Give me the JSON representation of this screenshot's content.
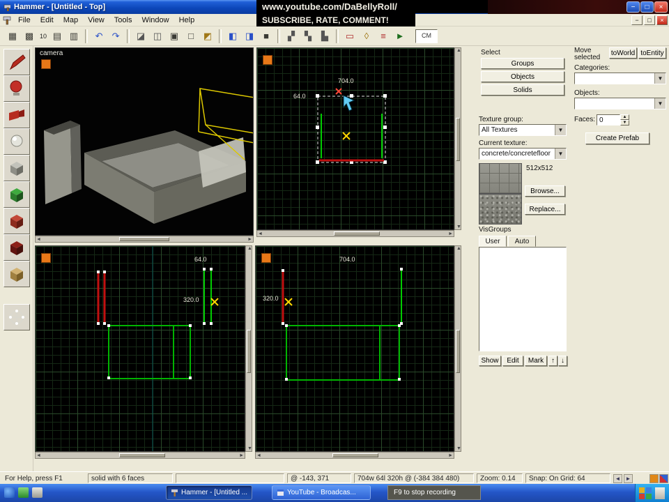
{
  "window": {
    "title": "Hammer - [Untitled - Top]"
  },
  "overlay": {
    "line1": "www.youtube.com/DaBellyRoll/",
    "line2": "SUBSCRIBE, RATE, COMMENT!",
    "recording": "F9 to stop recording"
  },
  "menu": {
    "items": [
      "File",
      "Edit",
      "Map",
      "View",
      "Tools",
      "Window",
      "Help"
    ]
  },
  "toolbar": {
    "grid_label": "10",
    "cm_label": "CM",
    "icons": {
      "toggle_grid": "▦",
      "grid_smaller": "▩",
      "load_window_state": "▤",
      "save_window_state": "▥",
      "undo": "↶",
      "redo": "↷",
      "carve": "◪",
      "make_hollow": "◫",
      "group": "▣",
      "ungroup": "□",
      "ignore_groups": "◩",
      "hide_selected": "◧",
      "hide_unselected": "◨",
      "show_all": "■",
      "cut": "▞",
      "copy": "▚",
      "paste": "▙",
      "cordon": "▭",
      "select_touching": "◊",
      "texture_lock": "≡",
      "run_map": "►"
    }
  },
  "viewports": {
    "camera_label": "camera",
    "top": {
      "w": "704.0",
      "h": "64.0"
    },
    "front": {
      "w": "64.0",
      "h": "320.0"
    },
    "side": {
      "w": "704.0",
      "h": "320.0"
    }
  },
  "texture_panel": {
    "select_label": "Select",
    "groups_btn": "Groups",
    "objects_btn": "Objects",
    "solids_btn": "Solids",
    "texture_group_label": "Texture group:",
    "texture_group_value": "All Textures",
    "current_texture_label": "Current texture:",
    "current_texture_value": "concrete/concretefloor",
    "texture_size": "512x512",
    "browse_btn": "Browse...",
    "replace_btn": "Replace...",
    "visgroups_label": "VisGroups",
    "tab_user": "User",
    "tab_auto": "Auto",
    "show_btn": "Show",
    "edit_btn": "Edit",
    "mark_btn": "Mark",
    "up_btn": "↑",
    "down_btn": "↓"
  },
  "object_panel": {
    "move_selected_label": "Move selected",
    "to_world_btn": "toWorld",
    "to_entity_btn": "toEntity",
    "categories_label": "Categories:",
    "objects_label": "Objects:",
    "faces_label": "Faces:",
    "faces_value": "0",
    "create_prefab_btn": "Create Prefab"
  },
  "status_bar": {
    "help": "For Help, press F1",
    "selection": "solid with 6 faces",
    "coordinates": "@ -143, 371",
    "dimensions": "704w 64l 320h @ (-384 384 480)",
    "zoom": "Zoom: 0.14",
    "snap": "Snap: On Grid: 64"
  },
  "taskbar": {
    "items": [
      {
        "label": "Hammer - [Untitled ..."
      },
      {
        "label": "YouTube - Broadcas..."
      }
    ]
  },
  "colors": {
    "titlebar_blue": "#0c46b8",
    "chrome_tan": "#ece9d8",
    "overlay_bg": "#000000",
    "overlay_text": "#f2efe4",
    "viewport_bg": "#000000",
    "grid_minor": "#152815",
    "grid_major": "#2a4a2a",
    "axis_teal": "#0c5858",
    "brush_green": "#00cc00",
    "brush_red": "#c01010",
    "selection_white": "#e0e0e0",
    "dim_text": "#e8e8d8",
    "marker_yellow": "#ffd800",
    "cursor_cyan": "#62ccf4",
    "viewport_marker_orange": "#e87818",
    "taskbar_blue": "#2456c8",
    "close_red": "#c22818"
  }
}
